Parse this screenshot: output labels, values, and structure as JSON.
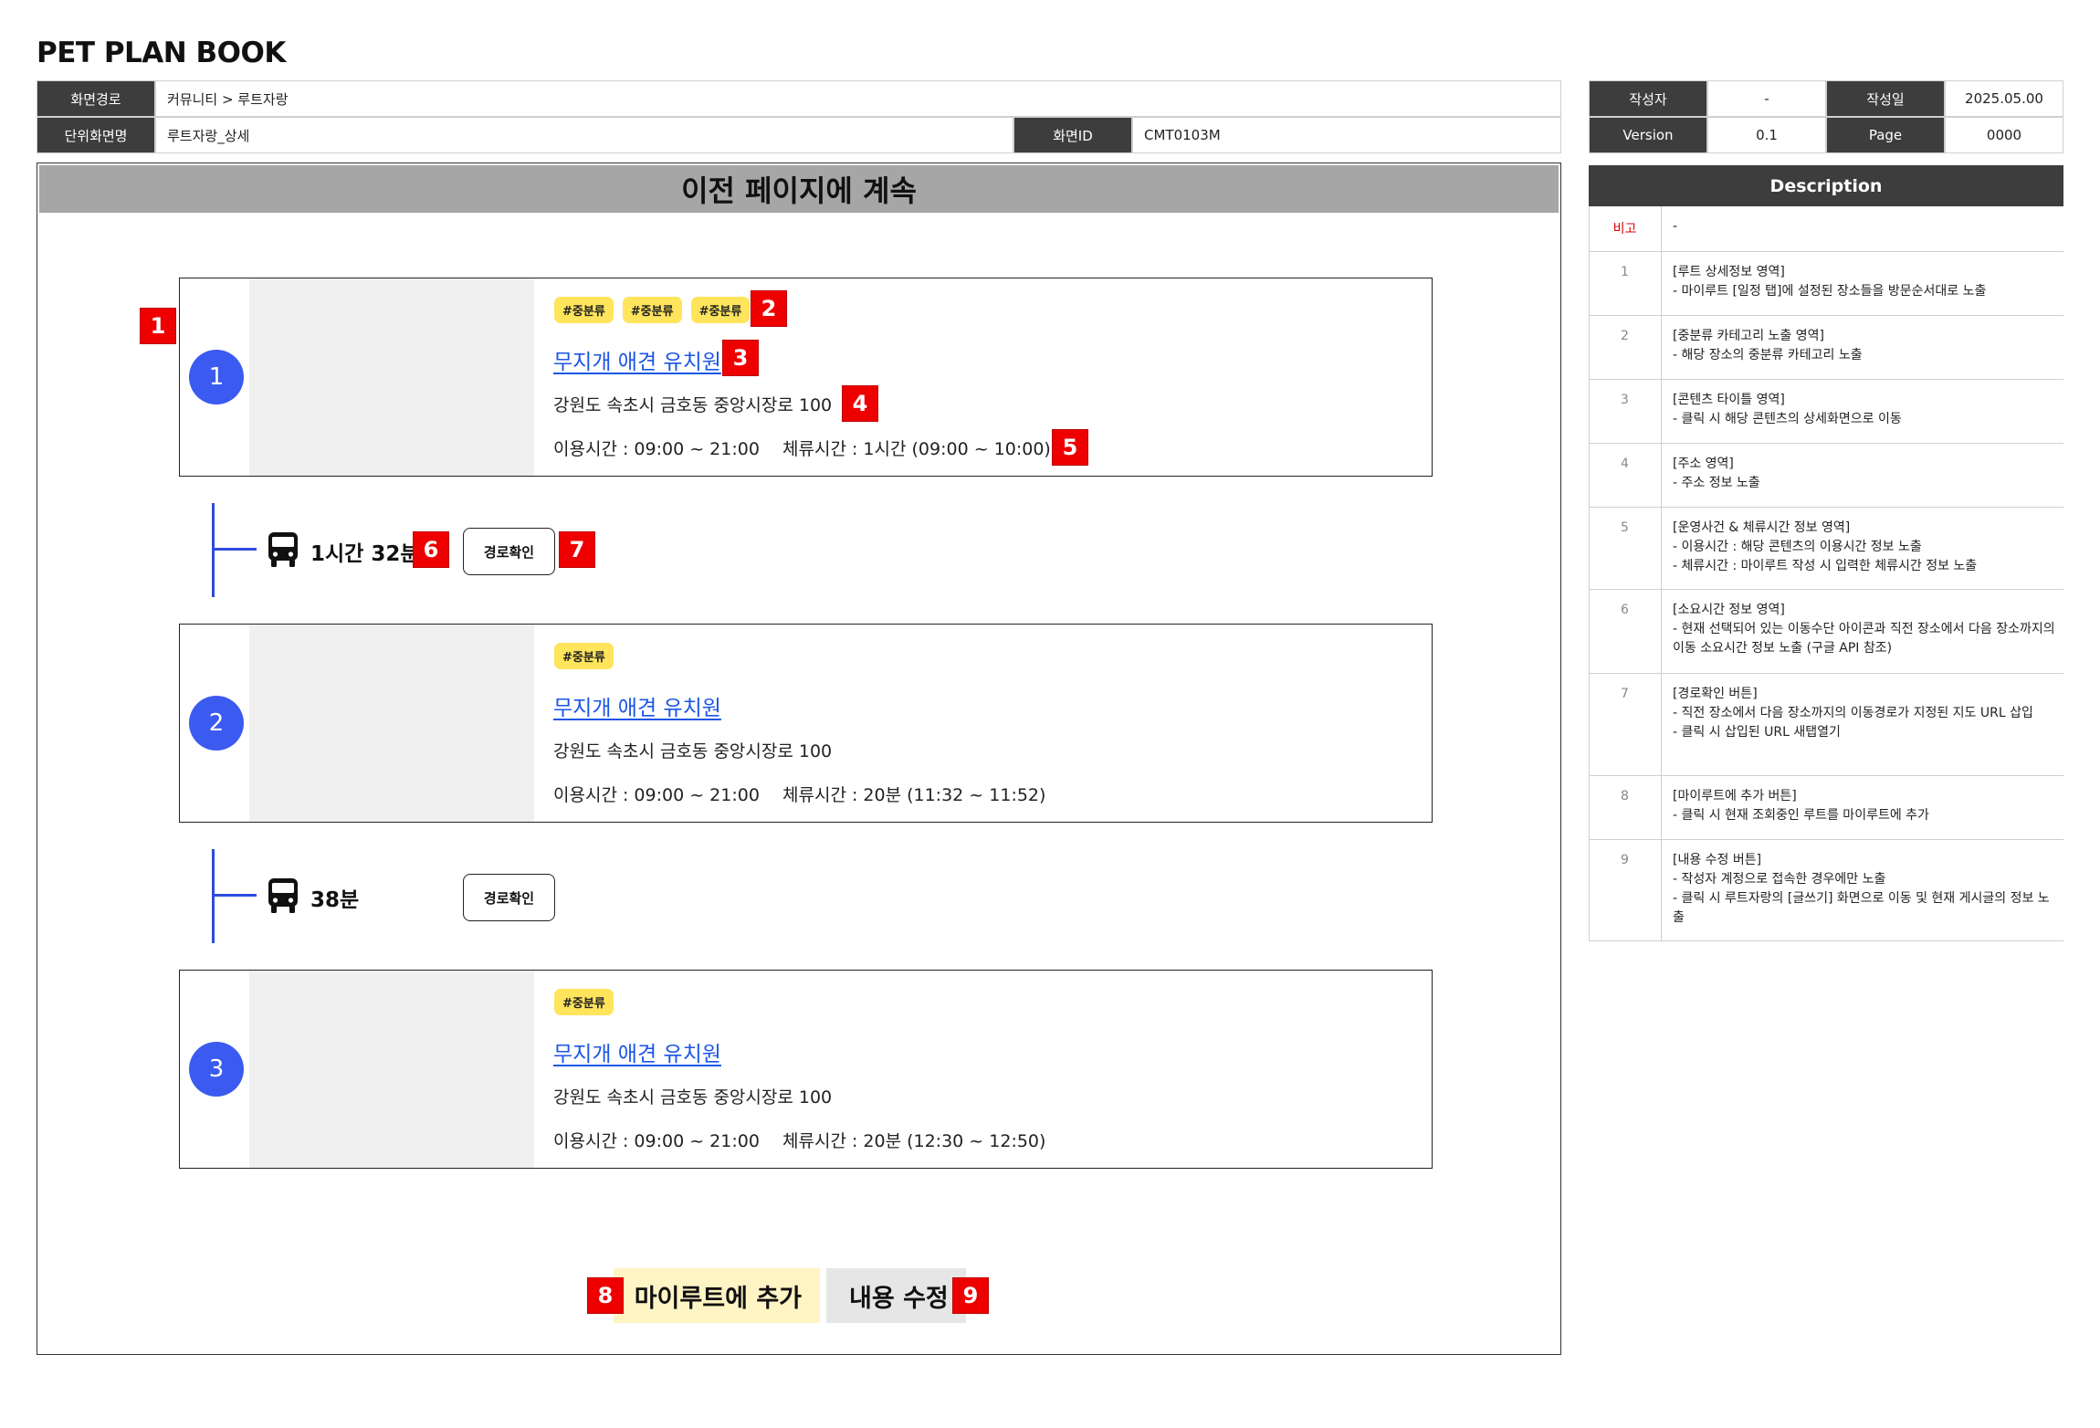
{
  "doc": {
    "title": "PET PLAN BOOK"
  },
  "meta": {
    "path_label": "화면경로",
    "path_value": "커뮤니티 > 루트자랑",
    "unit_label": "단위화면명",
    "unit_value": "루트자랑_상세",
    "screenid_label": "화면ID",
    "screenid_value": "CMT0103M",
    "author_label": "작성자",
    "author_value": "-",
    "date_label": "작성일",
    "date_value": "2025.05.00",
    "version_label": "Version",
    "version_value": "0.1",
    "page_label": "Page",
    "page_value": "0000"
  },
  "banner": "이전 페이지에 계속",
  "cards": [
    {
      "num": "1",
      "tags": [
        "#중분류",
        "#중분류",
        "#중분류"
      ],
      "title": "무지개 애견 유치원",
      "address": "강원도 속초시 금호동 중앙시장로 100",
      "hours": "이용시간 : 09:00 ~ 21:00",
      "stay": "체류시간 :  1시간  (09:00 ~ 10:00)"
    },
    {
      "num": "2",
      "tags": [
        "#중분류"
      ],
      "title": "무지개 애견 유치원",
      "address": "강원도 속초시 금호동 중앙시장로 100",
      "hours": "이용시간 : 09:00 ~ 21:00",
      "stay": "체류시간 :  20분  (11:32 ~ 11:52)"
    },
    {
      "num": "3",
      "tags": [
        "#중분류"
      ],
      "title": "무지개 애견 유치원",
      "address": "강원도 속초시 금호동 중앙시장로 100",
      "hours": "이용시간 : 09:00 ~ 21:00",
      "stay": "체류시간 :  20분  (12:30 ~ 12:50)"
    }
  ],
  "legs": [
    {
      "icon": "bus-icon",
      "duration": "1시간 32분",
      "button": "경로확인"
    },
    {
      "icon": "bus-icon",
      "duration": "38분",
      "button": "경로확인"
    }
  ],
  "buttons": {
    "add_myroute": "마이루트에 추가",
    "edit": "내용 수정"
  },
  "markers": [
    "1",
    "2",
    "3",
    "4",
    "5",
    "6",
    "7",
    "8",
    "9"
  ],
  "description": {
    "header": "Description",
    "note_label": "비고",
    "note_value": "-",
    "items": [
      {
        "num": "1",
        "text": "[루트 상세정보 영역]\n- 마이루트 [일정 탭]에 설정된 장소들을 방문순서대로 노출"
      },
      {
        "num": "2",
        "text": "[중분류 카테고리 노출 영역]\n- 해당 장소의 중분류 카테고리 노출"
      },
      {
        "num": "3",
        "text": "[콘텐츠 타이틀 영역]\n- 클릭 시 해당 콘텐츠의 상세화면으로 이동"
      },
      {
        "num": "4",
        "text": "[주소 영역]\n- 주소 정보 노출"
      },
      {
        "num": "5",
        "text": "[운영사건 & 체류시간 정보 영역]\n- 이용시간 : 해당 콘텐츠의 이용시간 정보 노출\n- 체류시간 : 마이루트 작성 시 입력한 체류시간 정보 노출"
      },
      {
        "num": "6",
        "text": "[소요시간 정보 영역]\n- 현재 선택되어 있는 이동수단 아이콘과 직전 장소에서 다음 장소까지의 이동 소요시간 정보 노출 (구글 API 참조)"
      },
      {
        "num": "7",
        "text": "[경로확인 버튼]\n- 직전 장소에서 다음 장소까지의 이동경로가 지정된 지도 URL 삽입\n- 클릭 시 삽입된 URL 새탭열기"
      },
      {
        "num": "8",
        "text": "[마이루트에 추가 버튼]\n- 클릭 시 현재 조회중인 루트를 마이루트에 추가"
      },
      {
        "num": "9",
        "text": "[내용 수정 버튼]\n- 작성자 계정으로 접속한 경우에만 노출\n- 클릭 시 루트자랑의 [글쓰기] 화면으로 이동 및 현재 게시글의 정보 노출"
      }
    ]
  },
  "colors": {
    "accent_blue": "#3b5bf0",
    "link_blue": "#1b56e6",
    "marker_red": "#ee0000",
    "tag_yellow": "#ffe45c",
    "header_dark": "#3d3d3d"
  }
}
